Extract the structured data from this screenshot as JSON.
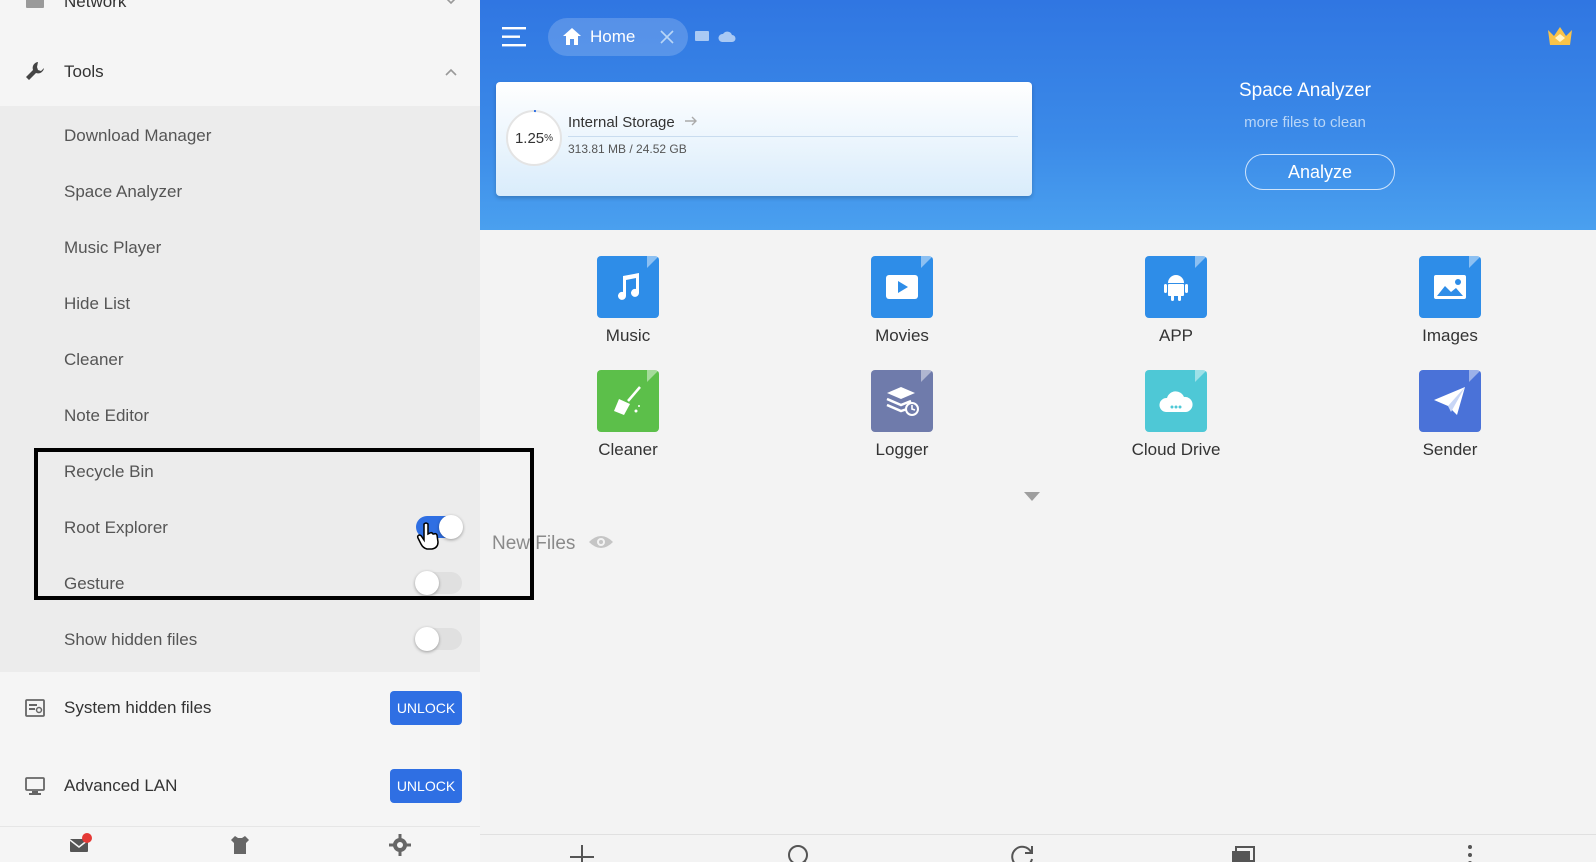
{
  "sidebar": {
    "network_label": "Network",
    "tools_label": "Tools",
    "tools_items": [
      {
        "label": "Download Manager"
      },
      {
        "label": "Space Analyzer"
      },
      {
        "label": "Music Player"
      },
      {
        "label": "Hide List"
      },
      {
        "label": "Cleaner"
      },
      {
        "label": "Note Editor"
      },
      {
        "label": "Recycle Bin"
      },
      {
        "label": "Root Explorer",
        "toggle": true
      },
      {
        "label": "Gesture",
        "toggle": false
      },
      {
        "label": "Show hidden files",
        "toggle": false
      }
    ],
    "system_hidden": {
      "label": "System hidden files",
      "button": "UNLOCK"
    },
    "advanced_lan": {
      "label": "Advanced LAN",
      "button": "UNLOCK"
    }
  },
  "header": {
    "tab_label": "Home",
    "storage": {
      "percent": "1.25",
      "percent_unit": "%",
      "title": "Internal Storage",
      "size": "313.81 MB / 24.52 GB"
    },
    "space_analyzer": {
      "title": "Space Analyzer",
      "subtitle": "more files to clean",
      "button": "Analyze"
    }
  },
  "categories": [
    {
      "label": "Music",
      "icon": "music-note-icon",
      "color": "#2e8de8"
    },
    {
      "label": "Movies",
      "icon": "play-icon",
      "color": "#2e8de8"
    },
    {
      "label": "APP",
      "icon": "android-icon",
      "color": "#2e8de8"
    },
    {
      "label": "Images",
      "icon": "image-icon",
      "color": "#2e8de8"
    },
    {
      "label": "Cleaner",
      "icon": "broom-icon",
      "color": "#5cbf4a"
    },
    {
      "label": "Logger",
      "icon": "layers-clock-icon",
      "color": "#6f7bab"
    },
    {
      "label": "Cloud Drive",
      "icon": "cloud-icon",
      "color": "#4ec8d6"
    },
    {
      "label": "Sender",
      "icon": "paper-plane-icon",
      "color": "#4a72d8"
    }
  ],
  "new_files_label": "New Files",
  "colors": {
    "accent": "#2f6fe3",
    "header": "#3076e2",
    "notification": "#e53935"
  }
}
